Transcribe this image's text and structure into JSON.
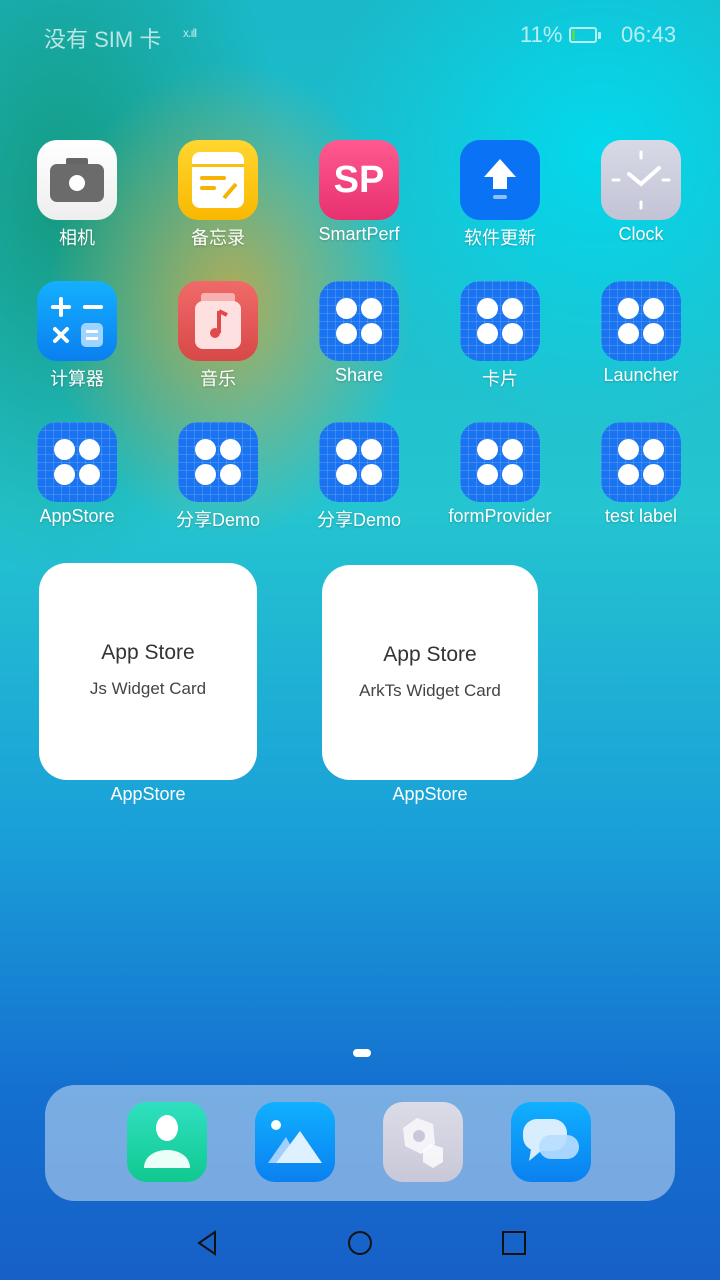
{
  "status": {
    "carrier": "没有 SIM 卡",
    "signal": "x.ıll",
    "battery": "11%",
    "time": "06:43"
  },
  "apps": [
    {
      "label": "相机",
      "icon": "camera-icon"
    },
    {
      "label": "备忘录",
      "icon": "notes-icon"
    },
    {
      "label": "SmartPerf",
      "icon": "smartperf-icon",
      "glyph": "SP"
    },
    {
      "label": "软件更新",
      "icon": "update-icon"
    },
    {
      "label": "Clock",
      "icon": "clock-icon"
    },
    {
      "label": "计算器",
      "icon": "calculator-icon"
    },
    {
      "label": "音乐",
      "icon": "music-icon"
    },
    {
      "label": "Share",
      "icon": "app-default-icon"
    },
    {
      "label": "卡片",
      "icon": "app-default-icon"
    },
    {
      "label": "Launcher",
      "icon": "app-default-icon"
    },
    {
      "label": "AppStore",
      "icon": "app-default-icon"
    },
    {
      "label": "分享Demo",
      "icon": "app-default-icon"
    },
    {
      "label": "分享Demo",
      "icon": "app-default-icon"
    },
    {
      "label": "formProvider",
      "icon": "app-default-icon"
    },
    {
      "label": "test label",
      "icon": "app-default-icon"
    }
  ],
  "widgets": [
    {
      "title": "App Store",
      "subtitle": "Js Widget Card",
      "label": "AppStore"
    },
    {
      "title": "App Store",
      "subtitle": "ArkTs Widget Card",
      "label": "AppStore"
    }
  ],
  "page_indicator": {
    "current": 1,
    "total": 1
  },
  "dock": [
    {
      "icon": "contacts-icon"
    },
    {
      "icon": "gallery-icon"
    },
    {
      "icon": "settings-icon"
    },
    {
      "icon": "messages-icon"
    }
  ],
  "nav": [
    "back",
    "home",
    "recents"
  ]
}
